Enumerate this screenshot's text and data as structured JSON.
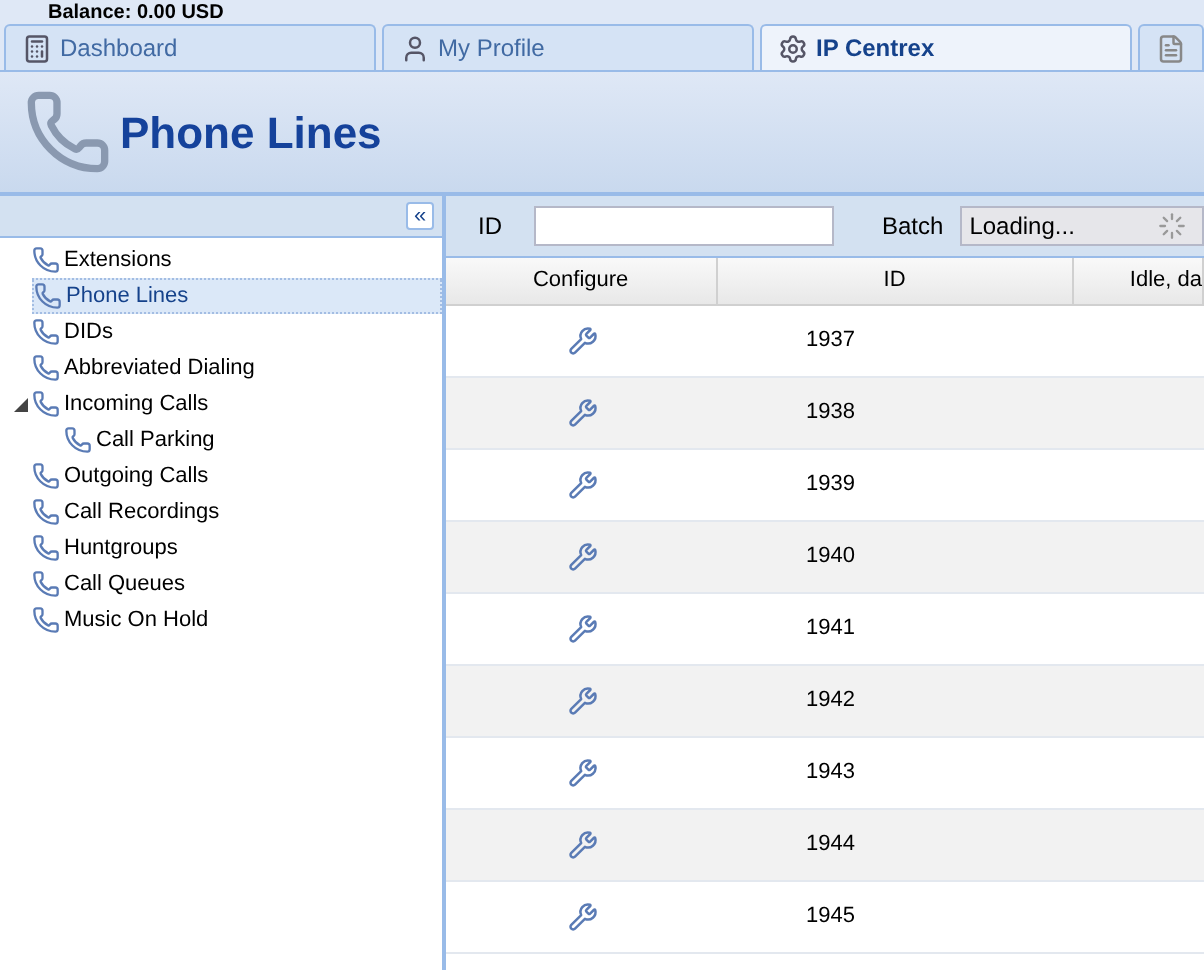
{
  "balance": "Balance: 0.00 USD",
  "tabs": [
    {
      "label": "Dashboard",
      "selected": false
    },
    {
      "label": "My Profile",
      "selected": false
    },
    {
      "label": "IP Centrex",
      "selected": true
    }
  ],
  "page_title": "Phone Lines",
  "sidebar": {
    "collapse_button": "«",
    "items": [
      {
        "label": "Extensions",
        "selected": false
      },
      {
        "label": "Phone Lines",
        "selected": true
      },
      {
        "label": "DIDs",
        "selected": false
      },
      {
        "label": "Abbreviated Dialing",
        "selected": false
      },
      {
        "label": "Incoming Calls",
        "selected": false,
        "expanded": true,
        "children": [
          {
            "label": "Call Parking",
            "selected": false
          }
        ]
      },
      {
        "label": "Outgoing Calls",
        "selected": false
      },
      {
        "label": "Call Recordings",
        "selected": false
      },
      {
        "label": "Huntgroups",
        "selected": false
      },
      {
        "label": "Call Queues",
        "selected": false
      },
      {
        "label": "Music On Hold",
        "selected": false
      }
    ]
  },
  "filter": {
    "id_label": "ID",
    "batch_label": "Batch",
    "batch_value": "Loading..."
  },
  "table": {
    "columns": [
      "Configure",
      "ID",
      "Idle, da"
    ],
    "rows": [
      {
        "id": "1937"
      },
      {
        "id": "1938"
      },
      {
        "id": "1939"
      },
      {
        "id": "1940"
      },
      {
        "id": "1941"
      },
      {
        "id": "1942"
      },
      {
        "id": "1943"
      },
      {
        "id": "1944"
      },
      {
        "id": "1945"
      }
    ]
  }
}
